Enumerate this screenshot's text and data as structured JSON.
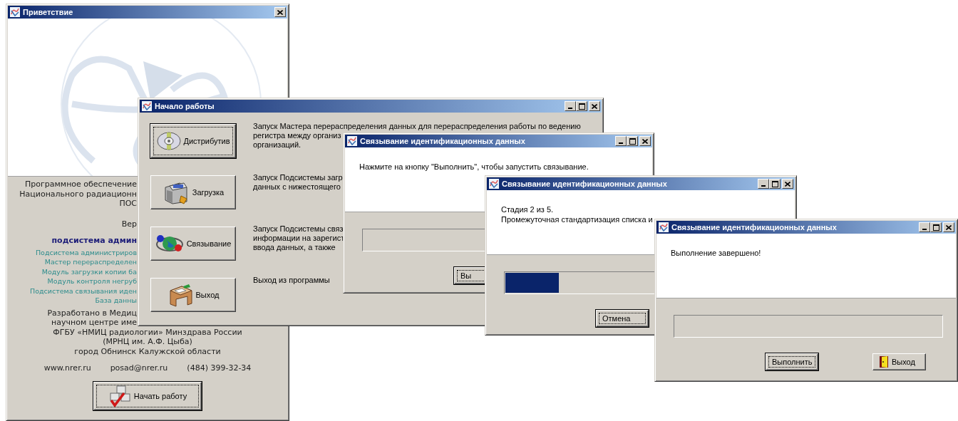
{
  "welcome_window": {
    "title": "Приветствие",
    "title_buttons": [
      {
        "kind": "close"
      }
    ],
    "about_lines": [
      "Программное обеспечение",
      "Национального радиационн",
      "ПОС"
    ],
    "version_label": "Вер",
    "subsystem_heading": "подсистема админ",
    "components": [
      "Подсистема администриров",
      "Мастер перераспределен",
      "Модуль загрузки копии ба",
      "Модуль контроля негруб",
      "Подсистема связывания иден",
      "База данны"
    ],
    "covered_credits": [
      "Разработано в Медиц",
      "научном центре име"
    ],
    "credits": [
      "ФГБУ «НМИЦ радиологии» Минздрава России",
      "(МРНЦ им. А.Ф. Цыба)",
      "город Обнинск Калужской области"
    ],
    "website": "www.nrer.ru",
    "email": "posad@nrer.ru",
    "phone": "(484) 399-32-34",
    "start_button": {
      "label": "Начать работу",
      "kind": "start",
      "focused": true
    }
  },
  "start_window": {
    "title": "Начало работы",
    "title_buttons": [
      {
        "kind": "minimize"
      },
      {
        "kind": "maximize"
      },
      {
        "kind": "close"
      }
    ],
    "actions": [
      {
        "button": {
          "label": "Дистрибутив",
          "kind": "distribute",
          "focused": true
        },
        "description": [
          "Запуск Мастера перераспределения данных для перераспределения работы по ведению",
          "регистра между организ",
          "организаций."
        ]
      },
      {
        "button": {
          "label": "Загрузка",
          "kind": "load",
          "focused": false
        },
        "description": [
          "Запуск Подсистемы загр",
          "данных с нижестоящего"
        ]
      },
      {
        "button": {
          "label": "Связывание",
          "kind": "link",
          "focused": false
        },
        "description": [
          "Запуск Подсистемы связ",
          "информации на зарегист",
          "ввода данных, а также"
        ]
      },
      {
        "button": {
          "label": "Выход",
          "kind": "quit",
          "focused": false
        },
        "description": [
          "Выход из программы"
        ]
      }
    ]
  },
  "linking_windows": [
    {
      "title": "Связывание идентификационных данных",
      "title_buttons": [
        {
          "kind": "minimize"
        },
        {
          "kind": "maximize"
        },
        {
          "kind": "close"
        }
      ],
      "message": [
        "Нажмите на кнопку \"Выполнить\", чтобы запустить связывание."
      ],
      "buttons": [
        {
          "label": "Вы",
          "kind": "plain",
          "focused": true
        }
      ]
    },
    {
      "title": "Связывание идентификационных данных",
      "title_buttons": [
        {
          "kind": "minimize"
        },
        {
          "kind": "maximize"
        },
        {
          "kind": "close"
        }
      ],
      "message": [
        "Стадия 2 из 5.",
        "Промежуточная стандартизация списка и"
      ],
      "progress": {
        "level": 0.2
      },
      "buttons": [
        {
          "label": "Отмена",
          "kind": "plain",
          "focused": true
        }
      ]
    },
    {
      "title": "Связывание идентификационных данных",
      "title_buttons": [
        {
          "kind": "minimize"
        },
        {
          "kind": "maximize"
        },
        {
          "kind": "close"
        }
      ],
      "message": [
        "Выполнение завершено!"
      ],
      "buttons": [
        {
          "label": "Выполнить",
          "kind": "plain",
          "focused": true
        },
        {
          "label": "Выход",
          "kind": "exit",
          "focused": false
        }
      ]
    }
  ]
}
